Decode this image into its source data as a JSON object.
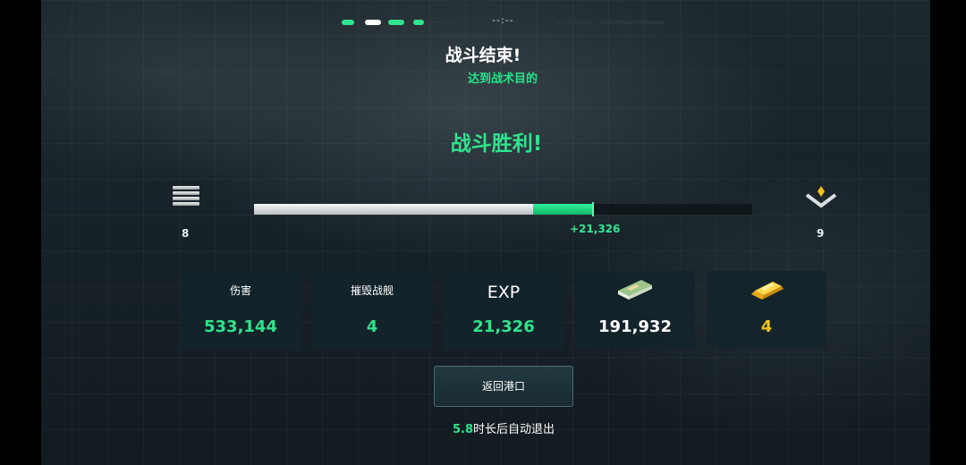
{
  "header": {
    "timer": "--:--",
    "title": "战斗结束!",
    "subtitle": "达到战术目的"
  },
  "result": {
    "label": "战斗胜利!"
  },
  "rank": {
    "current": "8",
    "next": "9"
  },
  "exp_bar": {
    "progress_before": 0.56,
    "progress_after": 0.68,
    "gain_label": "+21,326"
  },
  "stats": [
    {
      "label": "伤害",
      "value": "533,144",
      "value_color": "#2fe48d"
    },
    {
      "label": "摧毁战舰",
      "value": "4",
      "value_color": "#2fe48d"
    },
    {
      "label": "EXP",
      "value": "21,326",
      "value_color": "#2fe48d"
    },
    {
      "icon": "cash-stack-icon",
      "value": "191,932",
      "value_color": "#ffffff"
    },
    {
      "icon": "gold-bar-icon",
      "value": "4",
      "value_color": "#f0c419"
    }
  ],
  "actions": {
    "return_label": "返回港口",
    "auto_exit_seconds": "5.8",
    "auto_exit_text": "时长后自动退出"
  },
  "colors": {
    "accent_green": "#2fe48d",
    "gold": "#f0c419",
    "background": "#18232a"
  }
}
